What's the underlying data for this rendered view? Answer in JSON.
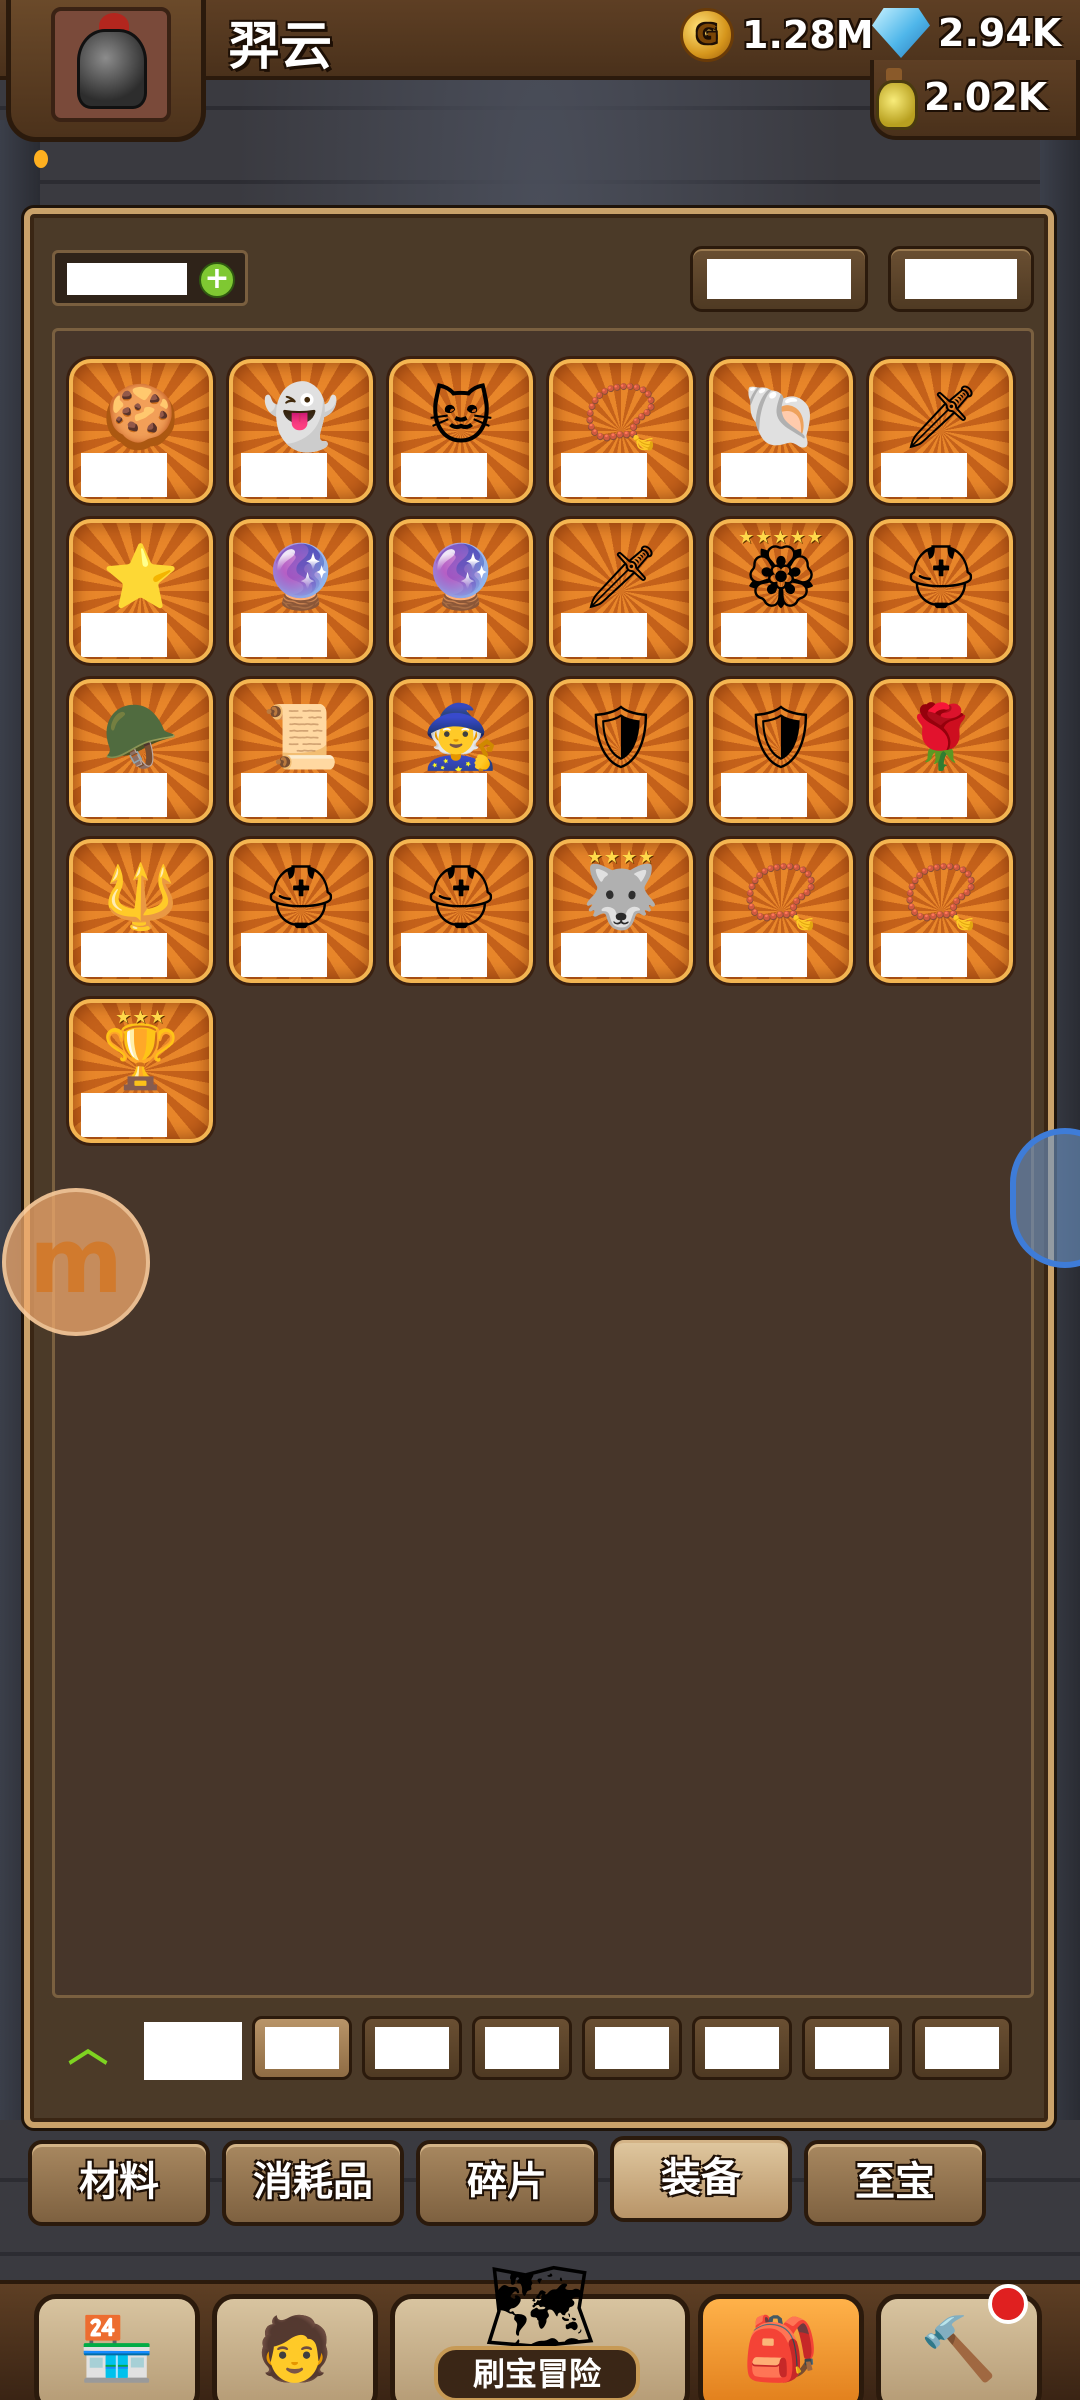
{
  "header": {
    "player_name": "羿云",
    "gold": "1.28M",
    "gems": "2.94K",
    "potions": "2.02K"
  },
  "inventory": {
    "items": [
      {
        "icon": "gingerbread-icon",
        "glyph": "🍪",
        "stars": ""
      },
      {
        "icon": "white-mask-icon",
        "glyph": "👻",
        "stars": ""
      },
      {
        "icon": "cat-hood-icon",
        "glyph": "🐱",
        "stars": ""
      },
      {
        "icon": "amulet-icon",
        "glyph": "📿",
        "stars": ""
      },
      {
        "icon": "shell-shield-icon",
        "glyph": "🐚",
        "stars": ""
      },
      {
        "icon": "light-sword-icon",
        "glyph": "🗡",
        "stars": ""
      },
      {
        "icon": "star-wand-icon",
        "glyph": "⭐",
        "stars": ""
      },
      {
        "icon": "crystal-staff-icon",
        "glyph": "🔮",
        "stars": ""
      },
      {
        "icon": "crystal-staff-icon",
        "glyph": "🔮",
        "stars": ""
      },
      {
        "icon": "light-sword-icon",
        "glyph": "🗡",
        "stars": ""
      },
      {
        "icon": "orb-staff-icon",
        "glyph": "🏵",
        "stars": "★★★★★"
      },
      {
        "icon": "red-helmet-icon",
        "glyph": "⛑",
        "stars": ""
      },
      {
        "icon": "army-helmet-icon",
        "glyph": "🪖",
        "stars": ""
      },
      {
        "icon": "scroll-icon",
        "glyph": "📜",
        "stars": ""
      },
      {
        "icon": "wizard-hat-icon",
        "glyph": "🧙",
        "stars": ""
      },
      {
        "icon": "dark-armor-icon",
        "glyph": "🛡",
        "stars": ""
      },
      {
        "icon": "blue-armor-icon",
        "glyph": "🛡",
        "stars": ""
      },
      {
        "icon": "flower-staff-icon",
        "glyph": "🌹",
        "stars": ""
      },
      {
        "icon": "spear-icon",
        "glyph": "🔱",
        "stars": ""
      },
      {
        "icon": "yellow-helmet-icon",
        "glyph": "⛑",
        "stars": ""
      },
      {
        "icon": "knight-helmet-icon",
        "glyph": "⛑",
        "stars": ""
      },
      {
        "icon": "wolf-icon",
        "glyph": "🐺",
        "stars": "★★★★"
      },
      {
        "icon": "pearl-bracelet-icon",
        "glyph": "📿",
        "stars": ""
      },
      {
        "icon": "amulet-icon",
        "glyph": "📿",
        "stars": ""
      },
      {
        "icon": "golden-goblet-icon",
        "glyph": "🏆",
        "stars": "★★★"
      }
    ]
  },
  "categories": [
    {
      "label": "材料",
      "active": false
    },
    {
      "label": "消耗品",
      "active": false
    },
    {
      "label": "碎片",
      "active": false
    },
    {
      "label": "装备",
      "active": true
    },
    {
      "label": "至宝",
      "active": false
    }
  ],
  "bottom_nav": {
    "center_label": "刷宝冒险",
    "items": [
      "shop-icon",
      "hero-icon",
      "adventure-map-icon",
      "backpack-icon",
      "forge-icon"
    ]
  },
  "colors": {
    "panel_bg": "#4b3a28",
    "slot_orange": "#e8862a",
    "slot_border": "#f3b552",
    "active_nav": "#ffb24a",
    "notification": "#e02020"
  }
}
